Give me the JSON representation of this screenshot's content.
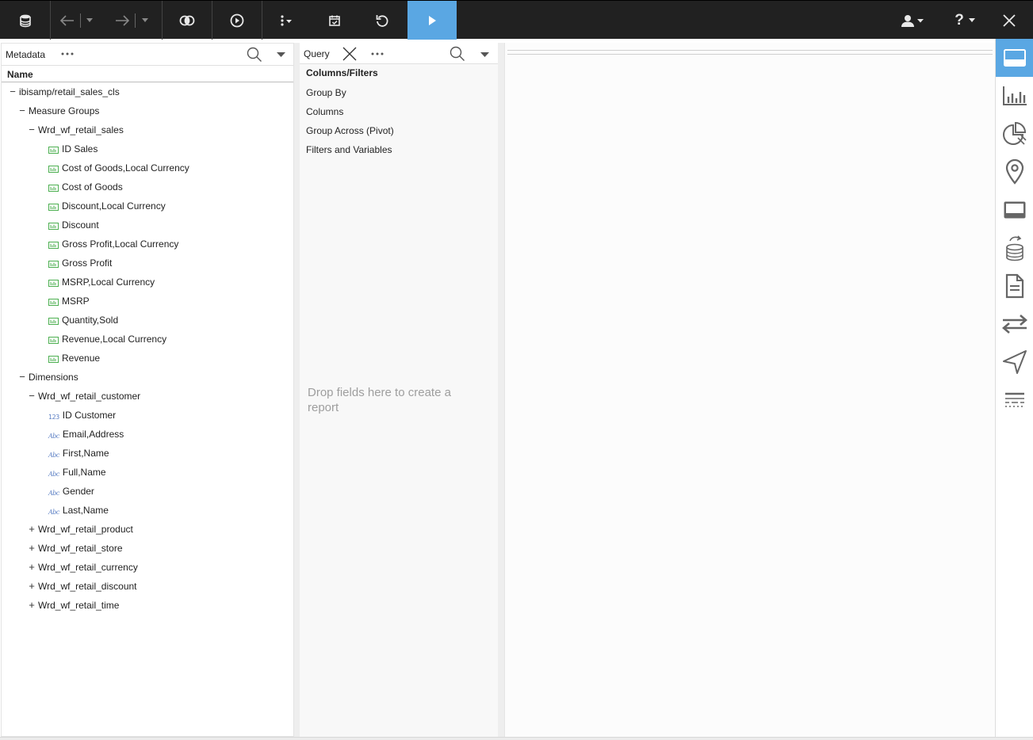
{
  "toolbar": {
    "buttons": [
      {
        "name": "data-source",
        "icon": "database-icon"
      },
      {
        "name": "back",
        "icon": "arrow-left-icon"
      },
      {
        "name": "back-menu",
        "icon": "chevron-down-icon"
      },
      {
        "name": "forward",
        "icon": "arrow-right-icon"
      },
      {
        "name": "forward-menu",
        "icon": "chevron-down-icon"
      },
      {
        "name": "join",
        "icon": "join-icon"
      },
      {
        "name": "preview",
        "icon": "play-circle-icon"
      },
      {
        "name": "more",
        "icon": "vertical-dots-icon"
      },
      {
        "name": "calendar",
        "icon": "calendar-check-icon"
      },
      {
        "name": "undo",
        "icon": "undo-icon"
      },
      {
        "name": "run",
        "icon": "play-icon"
      },
      {
        "name": "user",
        "icon": "user-icon"
      },
      {
        "name": "help",
        "icon": "help-icon"
      },
      {
        "name": "close",
        "icon": "close-icon"
      }
    ],
    "help_label": "?",
    "run_color": "#5aa7e3"
  },
  "metadata": {
    "title": "Metadata",
    "name_header": "Name",
    "tree": [
      {
        "label": "ibisamp/retail_sales_cls",
        "level": 0,
        "toggle": "−"
      },
      {
        "label": "Measure Groups",
        "level": 1,
        "toggle": "−"
      },
      {
        "label": "Wrd_wf_retail_sales",
        "level": 2,
        "toggle": "−"
      },
      {
        "label": "ID Sales",
        "level": 3,
        "icon": "measure"
      },
      {
        "label": "Cost of Goods,Local Currency",
        "level": 3,
        "icon": "measure"
      },
      {
        "label": "Cost of Goods",
        "level": 3,
        "icon": "measure"
      },
      {
        "label": "Discount,Local Currency",
        "level": 3,
        "icon": "measure"
      },
      {
        "label": "Discount",
        "level": 3,
        "icon": "measure"
      },
      {
        "label": "Gross Profit,Local Currency",
        "level": 3,
        "icon": "measure"
      },
      {
        "label": "Gross Profit",
        "level": 3,
        "icon": "measure"
      },
      {
        "label": "MSRP,Local Currency",
        "level": 3,
        "icon": "measure"
      },
      {
        "label": "MSRP",
        "level": 3,
        "icon": "measure"
      },
      {
        "label": "Quantity,Sold",
        "level": 3,
        "icon": "measure"
      },
      {
        "label": "Revenue,Local Currency",
        "level": 3,
        "icon": "measure"
      },
      {
        "label": "Revenue",
        "level": 3,
        "icon": "measure"
      },
      {
        "label": "Dimensions",
        "level": 1,
        "toggle": "−"
      },
      {
        "label": "Wrd_wf_retail_customer",
        "level": 2,
        "toggle": "−"
      },
      {
        "label": "ID Customer",
        "level": 3,
        "icon": "num",
        "icon_text": "123"
      },
      {
        "label": "Email,Address",
        "level": 3,
        "icon": "abc",
        "icon_text": "Abc"
      },
      {
        "label": "First,Name",
        "level": 3,
        "icon": "abc",
        "icon_text": "Abc"
      },
      {
        "label": "Full,Name",
        "level": 3,
        "icon": "abc",
        "icon_text": "Abc"
      },
      {
        "label": "Gender",
        "level": 3,
        "icon": "abc",
        "icon_text": "Abc"
      },
      {
        "label": "Last,Name",
        "level": 3,
        "icon": "abc",
        "icon_text": "Abc"
      },
      {
        "label": "Wrd_wf_retail_product",
        "level": 2,
        "toggle": "+"
      },
      {
        "label": "Wrd_wf_retail_store",
        "level": 2,
        "toggle": "+"
      },
      {
        "label": "Wrd_wf_retail_currency",
        "level": 2,
        "toggle": "+"
      },
      {
        "label": "Wrd_wf_retail_discount",
        "level": 2,
        "toggle": "+"
      },
      {
        "label": "Wrd_wf_retail_time",
        "level": 2,
        "toggle": "+"
      }
    ]
  },
  "query": {
    "title": "Query",
    "heading": "Columns/Filters",
    "items": [
      "Group By",
      "Columns",
      "Group Across (Pivot)",
      "Filters and Variables"
    ],
    "hint": "Drop fields here to create a report"
  },
  "rail": {
    "buttons": [
      {
        "name": "layout",
        "icon": "layout-icon",
        "active": true
      },
      {
        "name": "chart",
        "icon": "bar-chart-icon"
      },
      {
        "name": "pie",
        "icon": "pie-chart-icon"
      },
      {
        "name": "map",
        "icon": "map-pin-icon"
      },
      {
        "name": "panel",
        "icon": "panel-icon"
      },
      {
        "name": "data",
        "icon": "database-arrow-icon"
      },
      {
        "name": "document",
        "icon": "document-icon"
      },
      {
        "name": "swap",
        "icon": "swap-arrows-icon"
      },
      {
        "name": "navigate",
        "icon": "navigate-icon"
      },
      {
        "name": "separator",
        "icon": "dashed-lines-icon"
      }
    ],
    "active_color": "#5aa7e3"
  }
}
